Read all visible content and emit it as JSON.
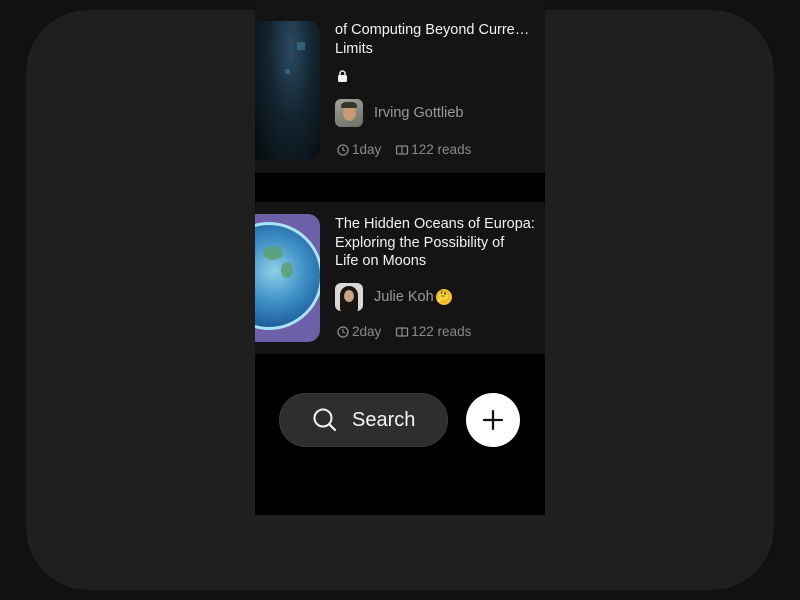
{
  "articles": [
    {
      "title": "of Computing Beyond Curre…\nLimits",
      "locked_icon": "lock-icon",
      "author": "Irving Gottlieb",
      "time": "1day",
      "reads": "122 reads"
    },
    {
      "title": "The Hidden Oceans of Europa:\nExploring the Possibility of\nLife on Moons",
      "author": "Julie Koh",
      "author_emoji": "🤔",
      "time": "2day",
      "reads": "122 reads"
    }
  ],
  "actions": {
    "search_label": "Search",
    "add_icon": "plus-icon"
  },
  "colors": {
    "background": "#1f1f1f",
    "screen": "#000000",
    "card": "#141414",
    "title": "#f2f2f2",
    "muted": "#8a8a8a",
    "search_pill": "#2e2e2e",
    "add_button": "#ffffff"
  }
}
